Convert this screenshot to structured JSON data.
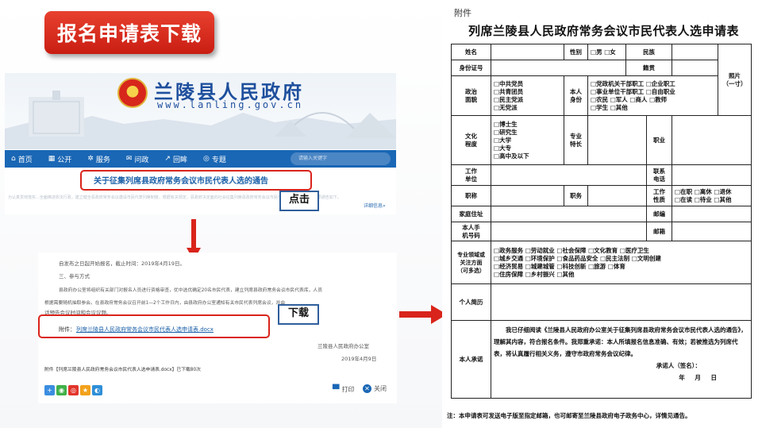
{
  "slide": {
    "title": "报名申请表下载",
    "click_label": "点击",
    "download_label": "下载"
  },
  "site": {
    "name": "兰陵县人民政府",
    "url": "www.lanling.gov.cn",
    "nav": [
      {
        "icon": "home-icon",
        "glyph": "⌂",
        "label": "首页"
      },
      {
        "icon": "building-icon",
        "glyph": "▦",
        "label": "公开"
      },
      {
        "icon": "service-icon",
        "glyph": "✲",
        "label": "服务"
      },
      {
        "icon": "chat-icon",
        "glyph": "✉",
        "label": "问政"
      },
      {
        "icon": "chart-icon",
        "glyph": "↗",
        "label": "回眸"
      },
      {
        "icon": "topic-icon",
        "glyph": "◎",
        "label": "专题"
      }
    ],
    "search_placeholder": "请输入关键字",
    "notice_title": "关于征集列席县政府常务会议市民代表人选的通告",
    "notice_summary": "为认真贯彻落实...全面推进依法行政，建立健全县政府常务会议邀请市民代表列席制度，根据有关规定，县政府决定面向社会征集列席县政府常务会议市民代表人选，现将有关事项通告如下。",
    "detail_link": "详细信息»"
  },
  "doc": {
    "line1": "自发布之日起开始报名，截止时间：2019年4月19日。",
    "line2": "三、参与方式",
    "line3": "县政府办公室将组织有关部门对报名人员进行资格审查，优中选优确定20名市民代表，建立列席县政府常务会议市民代表库，人员",
    "line4": "根据需要随机抽取参会。在县政府常务会议召开前1—2个工作日内，由县政府办公室通知有关市民代表列席会议，并由",
    "line5": "话预告会议时间和会议议题。",
    "attach_label": "附件：",
    "attach_file": "列席兰陵县人民政府常务会议市民代表人选申请表.docx",
    "issuer": "兰陵县人民政府办公室",
    "date": "2019年4月9日",
    "download_note": "附件【列席兰陵县人民政府常务会议市民代表人选申请表.docx】已下载80次",
    "print_label": "打印",
    "close_label": "关闭"
  },
  "form": {
    "attach_title": "附件",
    "title": "列席兰陵县人民政府常务会议市民代表人选申请表",
    "r1": {
      "name": "姓名",
      "gender": "性别",
      "gender_opts": "□男 □女",
      "ethnic": "民族",
      "photo": "照片\n（一寸）"
    },
    "r2": {
      "id": "身份证号",
      "native": "籍贯"
    },
    "r3": {
      "political": "政治\n面貌",
      "political_opts": "□中共党员\n□共青团员\n□民主党派\n□无党派",
      "identity": "本人\n身份",
      "identity_opts": "□党政机关干部职工 □企业职工\n□事业单位干部职工 □自由职业\n□农民 □军人 □商人 □教师\n□学生 □其他"
    },
    "r4": {
      "edu": "文化\n程度",
      "edu_opts": "□博士生\n□研究生\n□大学\n□大专\n□高中及以下",
      "specialty": "专业\n特长",
      "job": "职业"
    },
    "r5": {
      "unit": "工作\n单位",
      "phone": "联系\n电话"
    },
    "r6": {
      "title": "职称",
      "duty": "职务",
      "nature": "工作\n性质",
      "nature_opts": "□在职 □离休 □退休\n□在读 □待业 □其他"
    },
    "r7": {
      "address": "家庭住址",
      "postcode": "邮编"
    },
    "r8": {
      "mobile": "本人手\n机号码",
      "email": "邮箱"
    },
    "r9": {
      "field": "专业领域或\n关注方面\n（可多选）",
      "field_opts": "□政务服务 □劳动就业 □社会保障 □文化教育 □医疗卫生\n□城乡交通 □环境保护 □食品药品安全 □民主法制 □文明创建\n□经济贸易 □城建城管 □科技创新 □旅游 □体育\n□住房保障 □乡村振兴 □其他"
    },
    "r10": {
      "resume": "个人简历"
    },
    "r11": {
      "promise": "本人承诺",
      "promise_text": "我已仔细阅读《兰陵县人民政府办公室关于征集列席县政府常务会议市民代表人选的通告》，理解其内容，符合报名条件。我郑重承诺：本人所填报名信息准确、有效；若被推选为列席代表，将认真履行相关义务，遵守市政府常务会议纪律。",
      "sign": "承诺人（签名）：",
      "ymd": "年 月 日"
    },
    "note": "注：本申请表可发送电子版至指定邮箱，也可邮寄至兰陵县政府电子政务中心，详情见通告。"
  },
  "colors": {
    "accent_red": "#d9241b",
    "site_blue": "#1a67b5",
    "title_red": "#e8412f"
  }
}
